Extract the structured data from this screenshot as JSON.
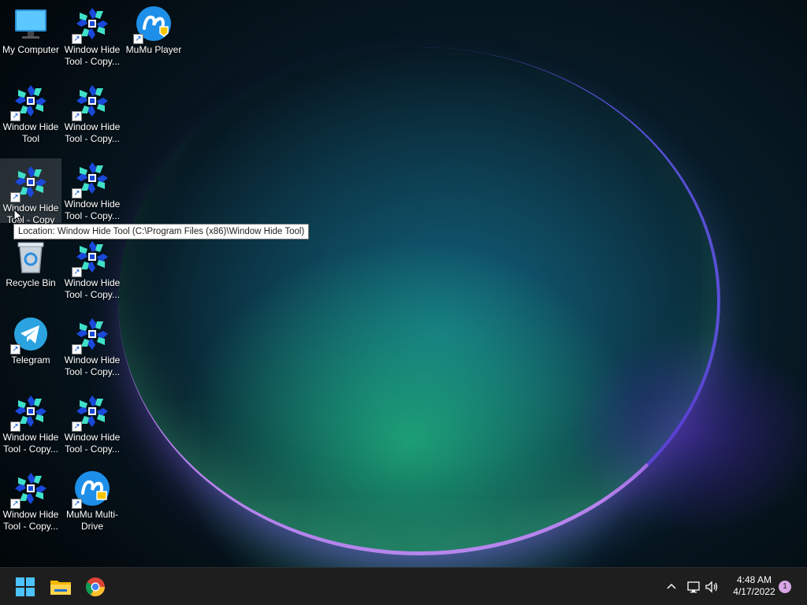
{
  "desktop": {
    "icons": [
      {
        "label": "My Computer",
        "icon": "my-computer-icon"
      },
      {
        "label": "Window Hide Tool - Copy...",
        "icon": "window-hide-tool-icon"
      },
      {
        "label": "MuMu Player",
        "icon": "mumu-player-icon"
      },
      {
        "label": "Window Hide Tool",
        "icon": "window-hide-tool-icon"
      },
      {
        "label": "Window Hide Tool - Copy...",
        "icon": "window-hide-tool-icon"
      },
      {
        "label": "Window Hide Tool - Copy",
        "icon": "window-hide-tool-icon"
      },
      {
        "label": "Window Hide Tool - Copy...",
        "icon": "window-hide-tool-icon"
      },
      {
        "label": "Recycle Bin",
        "icon": "recycle-bin-icon"
      },
      {
        "label": "Window Hide Tool - Copy...",
        "icon": "window-hide-tool-icon"
      },
      {
        "label": "Telegram",
        "icon": "telegram-icon"
      },
      {
        "label": "Window Hide Tool - Copy...",
        "icon": "window-hide-tool-icon"
      },
      {
        "label": "Window Hide Tool - Copy...",
        "icon": "window-hide-tool-icon"
      },
      {
        "label": "Window Hide Tool - Copy...",
        "icon": "window-hide-tool-icon"
      },
      {
        "label": "Window Hide Tool - Copy...",
        "icon": "window-hide-tool-icon"
      },
      {
        "label": "MuMu Multi-Drive",
        "icon": "mumu-multi-drive-icon"
      }
    ],
    "tooltip": "Location: Window Hide Tool (C:\\Program Files (x86)\\Window Hide Tool)"
  },
  "taskbar": {
    "buttons": [
      {
        "name": "Start",
        "icon": "windows-start-icon"
      },
      {
        "name": "File Explorer",
        "icon": "folder-icon"
      },
      {
        "name": "Google Chrome",
        "icon": "chrome-icon"
      }
    ],
    "tray": {
      "time": "4:48 AM",
      "date": "4/17/2022",
      "notification_count": "1"
    }
  },
  "colors": {
    "taskbar_bg": "#1e1e1e",
    "accent": "#0078d4",
    "notification_badge": "#d8a6e6"
  }
}
